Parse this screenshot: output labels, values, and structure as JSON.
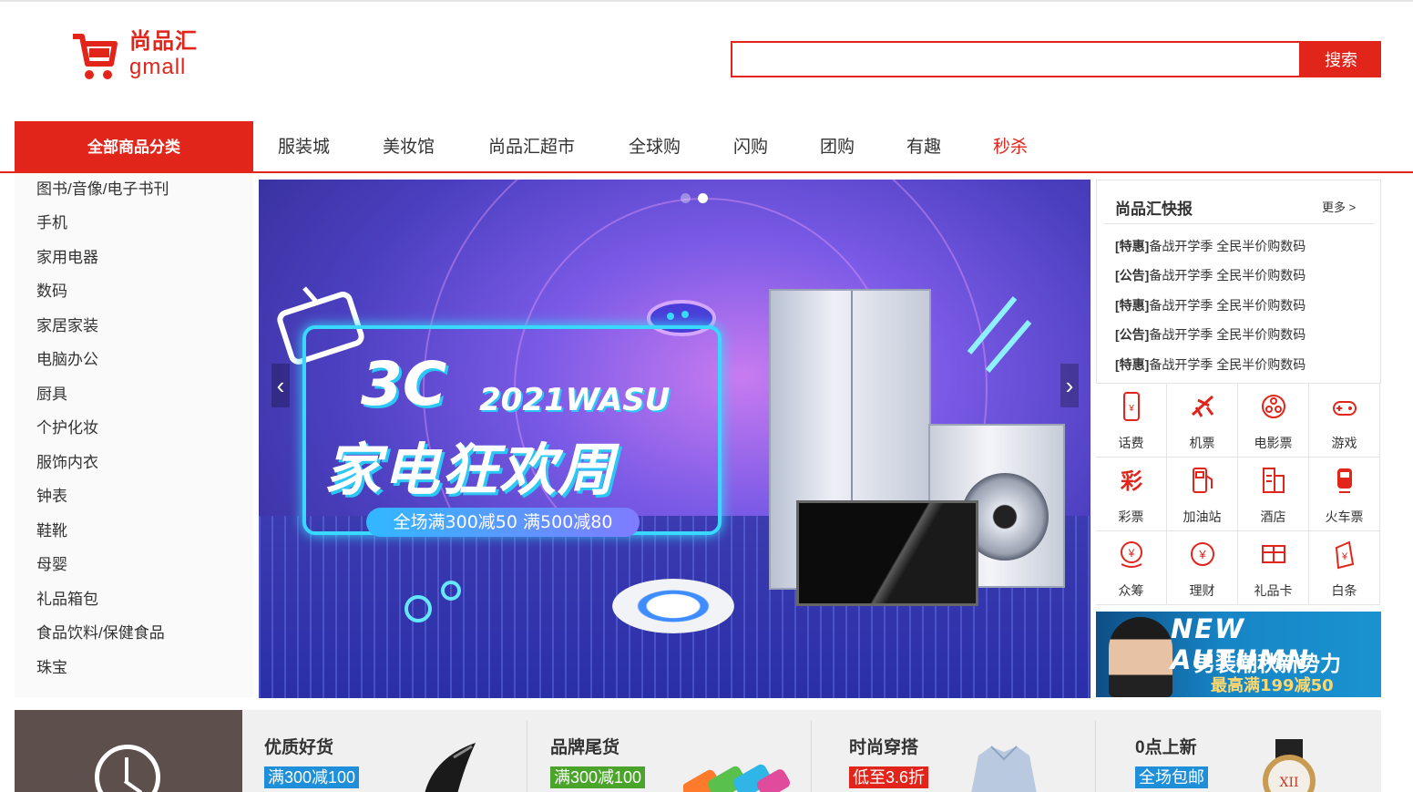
{
  "header": {
    "logo_cn": "尚品汇",
    "logo_en": "gmall",
    "search_value": "",
    "search_button": "搜索",
    "accent_color": "#e1251b"
  },
  "nav": {
    "all_categories": "全部商品分类",
    "items": [
      "服装城",
      "美妆馆",
      "尚品汇超市",
      "全球购",
      "闪购",
      "团购",
      "有趣",
      "秒杀"
    ]
  },
  "sidebar": {
    "items": [
      "图书/音像/电子书刊",
      "手机",
      "家用电器",
      "数码",
      "家居家装",
      "电脑办公",
      "厨具",
      "个护化妆",
      "服饰内衣",
      "钟表",
      "鞋靴",
      "母婴",
      "礼品箱包",
      "食品饮料/保健食品",
      "珠宝"
    ]
  },
  "banner": {
    "title_big": "3C",
    "title_sub": "2021WASU",
    "title_main": "家电狂欢周",
    "promo": "全场满300减50 满500减80",
    "prev_arrow": "‹",
    "next_arrow": "›",
    "slide_count": 2,
    "active_slide": 2
  },
  "news": {
    "title": "尚品汇快报",
    "more": "更多 >",
    "items": [
      {
        "tag": "[特惠]",
        "text": "备战开学季 全民半价购数码"
      },
      {
        "tag": "[公告]",
        "text": "备战开学季 全民半价购数码"
      },
      {
        "tag": "[特惠]",
        "text": "备战开学季 全民半价购数码"
      },
      {
        "tag": "[公告]",
        "text": "备战开学季 全民半价购数码"
      },
      {
        "tag": "[特惠]",
        "text": "备战开学季 全民半价购数码"
      }
    ]
  },
  "services": [
    {
      "label": "话费",
      "icon": "phone-icon"
    },
    {
      "label": "机票",
      "icon": "plane-icon"
    },
    {
      "label": "电影票",
      "icon": "film-icon"
    },
    {
      "label": "游戏",
      "icon": "gamepad-icon"
    },
    {
      "label": "彩票",
      "icon": "lottery-icon"
    },
    {
      "label": "加油站",
      "icon": "gas-station-icon"
    },
    {
      "label": "酒店",
      "icon": "hotel-icon"
    },
    {
      "label": "火车票",
      "icon": "train-icon"
    },
    {
      "label": "众筹",
      "icon": "crowdfunding-icon"
    },
    {
      "label": "理财",
      "icon": "finance-icon"
    },
    {
      "label": "礼品卡",
      "icon": "gift-card-icon"
    },
    {
      "label": "白条",
      "icon": "credit-icon"
    }
  ],
  "ad": {
    "line1": "NEW AUTUMN",
    "line2": "男装潮秋新势力",
    "line3": "最高满199减50"
  },
  "promos": [
    {
      "title": "优质好货",
      "tag": "满300减100",
      "tag_color": "#1e8fd8"
    },
    {
      "title": "品牌尾货",
      "tag": "满300减100",
      "tag_color": "#4aa42a"
    },
    {
      "title": "时尚穿搭",
      "tag": "低至3.6折",
      "tag_color": "#e1251b"
    },
    {
      "title": "0点上新",
      "tag": "全场包邮",
      "tag_color": "#1e8fd8"
    }
  ]
}
